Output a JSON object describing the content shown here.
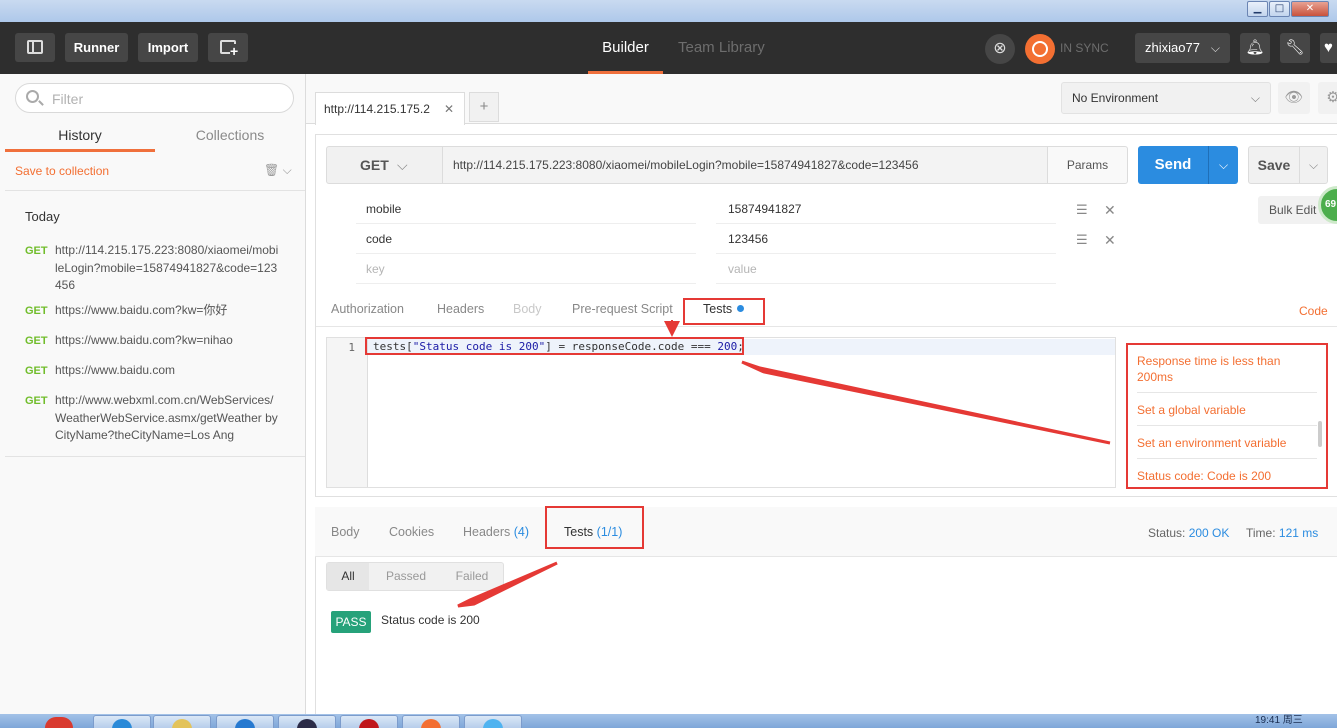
{
  "window": {
    "minimize": "▁",
    "maximize": "□",
    "close": "✕"
  },
  "header": {
    "runner": "Runner",
    "import": "Import",
    "tab_builder": "Builder",
    "tab_team_library": "Team Library",
    "sync_status": "IN SYNC",
    "username": "zhixiao77",
    "colors": {
      "accent": "#f0703c",
      "bg": "#2e2e2e"
    },
    "icons": [
      "sidebar-toggle-icon",
      "new-window-icon",
      "interceptor-icon",
      "sync-icon",
      "bell-icon",
      "wrench-icon",
      "heart-icon"
    ]
  },
  "sidebar": {
    "filter_placeholder": "Filter",
    "tab_history": "History",
    "tab_collections": "Collections",
    "save_to_collection": "Save to collection",
    "group": "Today",
    "history": [
      {
        "method": "GET",
        "url": "http://114.215.175.223:8080/xiaomei/mobileLogin?mobile=15874941827&code=123456"
      },
      {
        "method": "GET",
        "url": "https://www.baidu.com?kw=你好"
      },
      {
        "method": "GET",
        "url": "https://www.baidu.com?kw=nihao"
      },
      {
        "method": "GET",
        "url": "https://www.baidu.com"
      },
      {
        "method": "GET",
        "url": "http://www.webxml.com.cn/WebServices/WeatherWebService.asmx/getWeather byCityName?theCityName=Los Ang"
      }
    ]
  },
  "request_tabs": {
    "active_tab": "http://114.215.175.2",
    "add": "+"
  },
  "environment": {
    "selected": "No Environment"
  },
  "request": {
    "method": "GET",
    "url": "http://114.215.175.223:8080/xiaomei/mobileLogin?mobile=15874941827&code=123456",
    "params_label": "Params",
    "send_label": "Send",
    "save_label": "Save",
    "bulk_edit": "Bulk Edit",
    "badge": "69",
    "params": [
      {
        "key": "mobile",
        "value": "15874941827"
      },
      {
        "key": "code",
        "value": "123456"
      }
    ],
    "key_placeholder": "key",
    "value_placeholder": "value"
  },
  "request_subtabs": {
    "authorization": "Authorization",
    "headers": "Headers",
    "body": "Body",
    "pre_request": "Pre-request Script",
    "tests": "Tests",
    "code": "Code"
  },
  "editor": {
    "line_number": "1",
    "code_prefix": "tests[",
    "code_string": "\"Status code is 200\"",
    "code_mid": "] = responseCode.code === ",
    "code_number": "200",
    "code_suffix": ";"
  },
  "snippets": [
    "Response time is less than 200ms",
    "Set a global variable",
    "Set an environment variable",
    "Status code: Code is 200"
  ],
  "response": {
    "tab_body": "Body",
    "tab_cookies": "Cookies",
    "tab_headers": "Headers",
    "headers_count": "(4)",
    "tab_tests": "Tests",
    "tests_count": "(1/1)",
    "status_label": "Status:",
    "status_value": "200 OK",
    "time_label": "Time:",
    "time_value": "121 ms",
    "filter_all": "All",
    "filter_passed": "Passed",
    "filter_failed": "Failed",
    "result_badge": "PASS",
    "result_text": "Status code is 200"
  },
  "taskbar": {
    "clock": "19:41 周三"
  }
}
